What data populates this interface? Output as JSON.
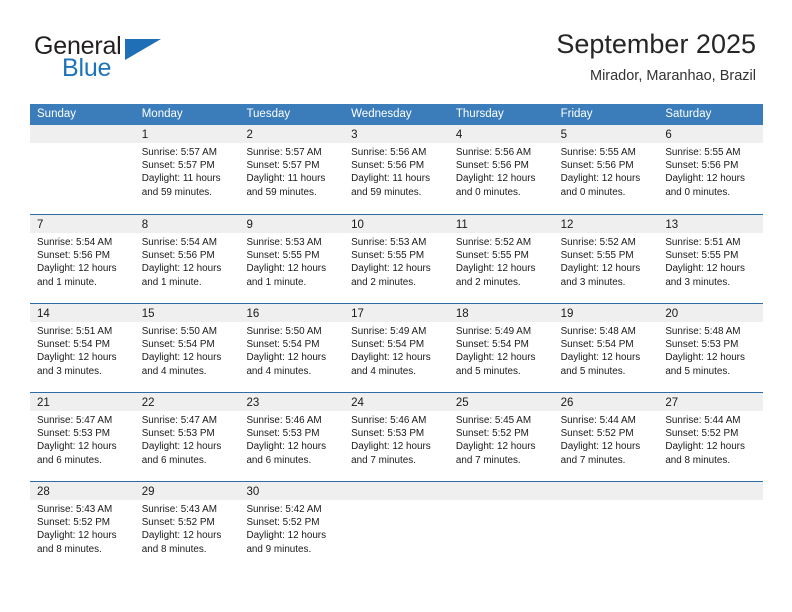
{
  "brand": {
    "word_one": "General",
    "word_two": "Blue",
    "flag_icon": "triangle-flag-icon",
    "color_blue": "#1e74bb",
    "color_dark": "#231f20"
  },
  "header": {
    "month_title": "September 2025",
    "location": "Mirador, Maranhao, Brazil"
  },
  "calendar": {
    "header_bg": "#3a7dba",
    "daynum_bg": "#efefef",
    "row_border": "#2d6da4",
    "weekdays": [
      "Sunday",
      "Monday",
      "Tuesday",
      "Wednesday",
      "Thursday",
      "Friday",
      "Saturday"
    ],
    "weeks": [
      [
        {
          "day": "",
          "lines": []
        },
        {
          "day": "1",
          "lines": [
            "Sunrise: 5:57 AM",
            "Sunset: 5:57 PM",
            "Daylight: 11 hours",
            "and 59 minutes."
          ]
        },
        {
          "day": "2",
          "lines": [
            "Sunrise: 5:57 AM",
            "Sunset: 5:57 PM",
            "Daylight: 11 hours",
            "and 59 minutes."
          ]
        },
        {
          "day": "3",
          "lines": [
            "Sunrise: 5:56 AM",
            "Sunset: 5:56 PM",
            "Daylight: 11 hours",
            "and 59 minutes."
          ]
        },
        {
          "day": "4",
          "lines": [
            "Sunrise: 5:56 AM",
            "Sunset: 5:56 PM",
            "Daylight: 12 hours",
            "and 0 minutes."
          ]
        },
        {
          "day": "5",
          "lines": [
            "Sunrise: 5:55 AM",
            "Sunset: 5:56 PM",
            "Daylight: 12 hours",
            "and 0 minutes."
          ]
        },
        {
          "day": "6",
          "lines": [
            "Sunrise: 5:55 AM",
            "Sunset: 5:56 PM",
            "Daylight: 12 hours",
            "and 0 minutes."
          ]
        }
      ],
      [
        {
          "day": "7",
          "lines": [
            "Sunrise: 5:54 AM",
            "Sunset: 5:56 PM",
            "Daylight: 12 hours",
            "and 1 minute."
          ]
        },
        {
          "day": "8",
          "lines": [
            "Sunrise: 5:54 AM",
            "Sunset: 5:56 PM",
            "Daylight: 12 hours",
            "and 1 minute."
          ]
        },
        {
          "day": "9",
          "lines": [
            "Sunrise: 5:53 AM",
            "Sunset: 5:55 PM",
            "Daylight: 12 hours",
            "and 1 minute."
          ]
        },
        {
          "day": "10",
          "lines": [
            "Sunrise: 5:53 AM",
            "Sunset: 5:55 PM",
            "Daylight: 12 hours",
            "and 2 minutes."
          ]
        },
        {
          "day": "11",
          "lines": [
            "Sunrise: 5:52 AM",
            "Sunset: 5:55 PM",
            "Daylight: 12 hours",
            "and 2 minutes."
          ]
        },
        {
          "day": "12",
          "lines": [
            "Sunrise: 5:52 AM",
            "Sunset: 5:55 PM",
            "Daylight: 12 hours",
            "and 3 minutes."
          ]
        },
        {
          "day": "13",
          "lines": [
            "Sunrise: 5:51 AM",
            "Sunset: 5:55 PM",
            "Daylight: 12 hours",
            "and 3 minutes."
          ]
        }
      ],
      [
        {
          "day": "14",
          "lines": [
            "Sunrise: 5:51 AM",
            "Sunset: 5:54 PM",
            "Daylight: 12 hours",
            "and 3 minutes."
          ]
        },
        {
          "day": "15",
          "lines": [
            "Sunrise: 5:50 AM",
            "Sunset: 5:54 PM",
            "Daylight: 12 hours",
            "and 4 minutes."
          ]
        },
        {
          "day": "16",
          "lines": [
            "Sunrise: 5:50 AM",
            "Sunset: 5:54 PM",
            "Daylight: 12 hours",
            "and 4 minutes."
          ]
        },
        {
          "day": "17",
          "lines": [
            "Sunrise: 5:49 AM",
            "Sunset: 5:54 PM",
            "Daylight: 12 hours",
            "and 4 minutes."
          ]
        },
        {
          "day": "18",
          "lines": [
            "Sunrise: 5:49 AM",
            "Sunset: 5:54 PM",
            "Daylight: 12 hours",
            "and 5 minutes."
          ]
        },
        {
          "day": "19",
          "lines": [
            "Sunrise: 5:48 AM",
            "Sunset: 5:54 PM",
            "Daylight: 12 hours",
            "and 5 minutes."
          ]
        },
        {
          "day": "20",
          "lines": [
            "Sunrise: 5:48 AM",
            "Sunset: 5:53 PM",
            "Daylight: 12 hours",
            "and 5 minutes."
          ]
        }
      ],
      [
        {
          "day": "21",
          "lines": [
            "Sunrise: 5:47 AM",
            "Sunset: 5:53 PM",
            "Daylight: 12 hours",
            "and 6 minutes."
          ]
        },
        {
          "day": "22",
          "lines": [
            "Sunrise: 5:47 AM",
            "Sunset: 5:53 PM",
            "Daylight: 12 hours",
            "and 6 minutes."
          ]
        },
        {
          "day": "23",
          "lines": [
            "Sunrise: 5:46 AM",
            "Sunset: 5:53 PM",
            "Daylight: 12 hours",
            "and 6 minutes."
          ]
        },
        {
          "day": "24",
          "lines": [
            "Sunrise: 5:46 AM",
            "Sunset: 5:53 PM",
            "Daylight: 12 hours",
            "and 7 minutes."
          ]
        },
        {
          "day": "25",
          "lines": [
            "Sunrise: 5:45 AM",
            "Sunset: 5:52 PM",
            "Daylight: 12 hours",
            "and 7 minutes."
          ]
        },
        {
          "day": "26",
          "lines": [
            "Sunrise: 5:44 AM",
            "Sunset: 5:52 PM",
            "Daylight: 12 hours",
            "and 7 minutes."
          ]
        },
        {
          "day": "27",
          "lines": [
            "Sunrise: 5:44 AM",
            "Sunset: 5:52 PM",
            "Daylight: 12 hours",
            "and 8 minutes."
          ]
        }
      ],
      [
        {
          "day": "28",
          "lines": [
            "Sunrise: 5:43 AM",
            "Sunset: 5:52 PM",
            "Daylight: 12 hours",
            "and 8 minutes."
          ]
        },
        {
          "day": "29",
          "lines": [
            "Sunrise: 5:43 AM",
            "Sunset: 5:52 PM",
            "Daylight: 12 hours",
            "and 8 minutes."
          ]
        },
        {
          "day": "30",
          "lines": [
            "Sunrise: 5:42 AM",
            "Sunset: 5:52 PM",
            "Daylight: 12 hours",
            "and 9 minutes."
          ]
        },
        {
          "day": "",
          "lines": []
        },
        {
          "day": "",
          "lines": []
        },
        {
          "day": "",
          "lines": []
        },
        {
          "day": "",
          "lines": []
        }
      ]
    ]
  }
}
